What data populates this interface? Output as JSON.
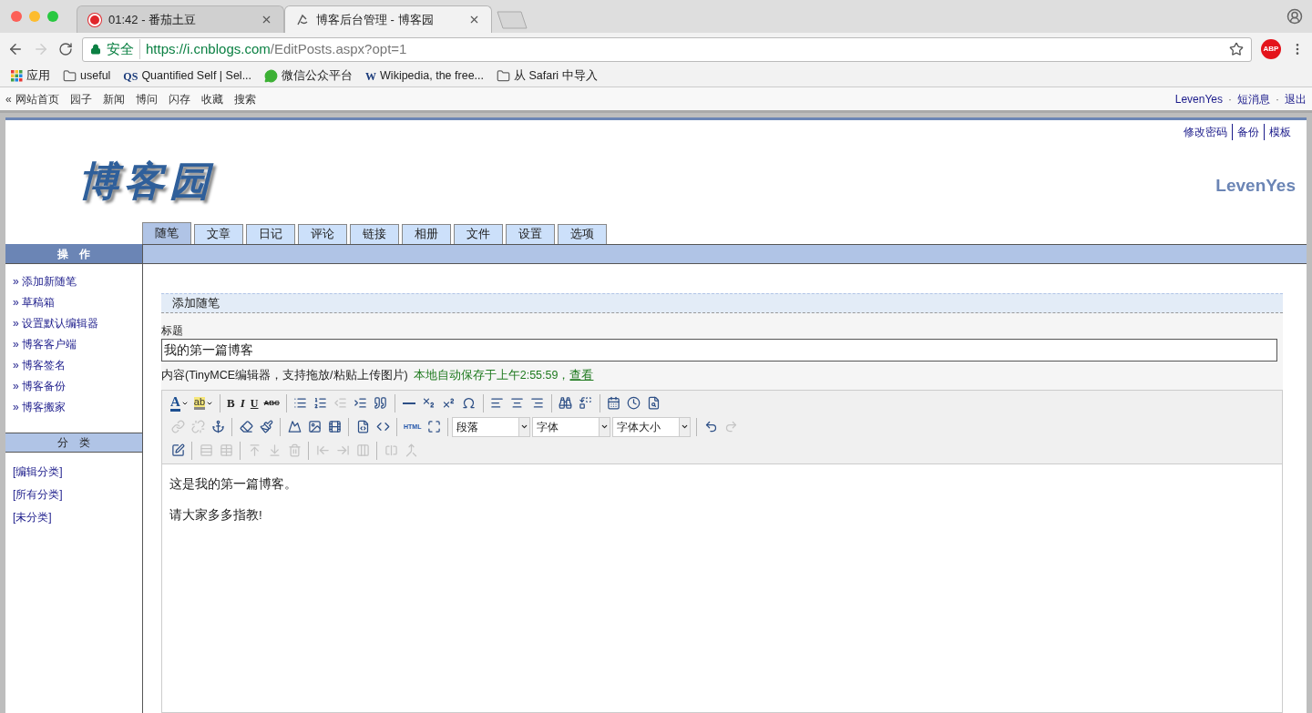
{
  "browser": {
    "tabs": [
      {
        "title": "01:42 - 番茄土豆",
        "kind": "tomato",
        "selected": false
      },
      {
        "title": "博客后台管理 - 博客园",
        "kind": "site",
        "selected": true
      }
    ],
    "back_disabled": false,
    "forward_disabled": true,
    "address": {
      "secure_label": "安全",
      "url_host": "https://i.cnblogs.com",
      "url_path": "/EditPosts.aspx?opt=1"
    },
    "extension_label": "ABP",
    "bookmarks": [
      {
        "kind": "apps",
        "label": "应用"
      },
      {
        "kind": "folder",
        "label": "useful"
      },
      {
        "kind": "badge",
        "badge": "QS",
        "label": "Quantified Self | Sel..."
      },
      {
        "kind": "chat",
        "label": "微信公众平台"
      },
      {
        "kind": "badge",
        "badge": "W",
        "label": "Wikipedia, the free..."
      },
      {
        "kind": "folder",
        "label": "从 Safari 中导入"
      }
    ]
  },
  "site_nav": {
    "marker": "«",
    "links": [
      "网站首页",
      "园子",
      "新闻",
      "博问",
      "闪存",
      "收藏",
      "搜索"
    ],
    "user_links": [
      "LevenYes",
      "短消息",
      "退出"
    ],
    "separator": "·"
  },
  "header": {
    "top_links": [
      "修改密码",
      "备份",
      "模板"
    ],
    "logo": "博客园",
    "username": "LevenYes"
  },
  "tabs": [
    {
      "label": "随笔",
      "selected": true
    },
    {
      "label": "文章",
      "selected": false
    },
    {
      "label": "日记",
      "selected": false
    },
    {
      "label": "评论",
      "selected": false
    },
    {
      "label": "链接",
      "selected": false
    },
    {
      "label": "相册",
      "selected": false
    },
    {
      "label": "文件",
      "selected": false
    },
    {
      "label": "设置",
      "selected": false
    },
    {
      "label": "选项",
      "selected": false
    }
  ],
  "sidebar": {
    "operations_title": "操　作",
    "bullet": "»",
    "operations": [
      "添加新随笔",
      "草稿箱",
      "设置默认编辑器",
      "博客客户端",
      "博客签名",
      "博客备份",
      "博客搬家"
    ],
    "categories_title": "分　类",
    "categories": [
      "[编辑分类]",
      "[所有分类]",
      "[未分类]"
    ]
  },
  "form": {
    "section_title": "添加随笔",
    "title_label": "标题",
    "title_value": "我的第一篇博客",
    "content_label": "内容(TinyMCE编辑器，支持拖放/粘贴上传图片)",
    "autosave_note": "本地自动保存于上午2:55:59，",
    "autosave_link": "查看"
  },
  "toolbar_rows": [
    [
      {
        "kind": "forecolor",
        "label": "A",
        "disabled": false
      },
      {
        "kind": "backcolor",
        "label": "ab",
        "disabled": false
      },
      {
        "kind": "separator"
      },
      {
        "kind": "bold",
        "label": "B",
        "disabled": false
      },
      {
        "kind": "italic",
        "label": "I",
        "disabled": false
      },
      {
        "kind": "underline",
        "label": "U",
        "disabled": false
      },
      {
        "kind": "strike",
        "label": "ABC",
        "disabled": false
      },
      {
        "kind": "separator"
      },
      {
        "kind": "bullist",
        "disabled": false
      },
      {
        "kind": "numlist",
        "disabled": false
      },
      {
        "kind": "outdent",
        "disabled": true
      },
      {
        "kind": "indent",
        "disabled": false
      },
      {
        "kind": "blockquote",
        "disabled": false
      },
      {
        "kind": "separator"
      },
      {
        "kind": "hr",
        "disabled": false
      },
      {
        "kind": "sub",
        "disabled": false
      },
      {
        "kind": "sup",
        "disabled": false
      },
      {
        "kind": "charmap",
        "disabled": false
      },
      {
        "kind": "separator"
      },
      {
        "kind": "alignleft",
        "disabled": false
      },
      {
        "kind": "aligncenter",
        "disabled": false
      },
      {
        "kind": "alignright",
        "disabled": false
      },
      {
        "kind": "separator"
      },
      {
        "kind": "search",
        "disabled": false
      },
      {
        "kind": "replace",
        "disabled": false
      },
      {
        "kind": "separator"
      },
      {
        "kind": "date",
        "disabled": false
      },
      {
        "kind": "time",
        "disabled": false
      },
      {
        "kind": "preview",
        "disabled": false
      }
    ],
    [
      {
        "kind": "link",
        "disabled": true
      },
      {
        "kind": "unlink",
        "disabled": true
      },
      {
        "kind": "anchor",
        "disabled": false
      },
      {
        "kind": "separator"
      },
      {
        "kind": "cleanup",
        "disabled": false
      },
      {
        "kind": "paint",
        "disabled": false
      },
      {
        "kind": "separator"
      },
      {
        "kind": "picture",
        "disabled": false
      },
      {
        "kind": "image",
        "disabled": false
      },
      {
        "kind": "media",
        "disabled": false
      },
      {
        "kind": "separator"
      },
      {
        "kind": "code",
        "disabled": false
      },
      {
        "kind": "code2",
        "disabled": false
      },
      {
        "kind": "separator"
      },
      {
        "kind": "html",
        "label": "HTML",
        "disabled": false
      },
      {
        "kind": "fullscreen",
        "disabled": false
      },
      {
        "kind": "separator"
      },
      {
        "kind": "select",
        "label": "段落"
      },
      {
        "kind": "select",
        "label": "字体"
      },
      {
        "kind": "select",
        "label": "字体大小"
      },
      {
        "kind": "separator"
      },
      {
        "kind": "undo",
        "disabled": false
      },
      {
        "kind": "redo",
        "disabled": true
      }
    ],
    [
      {
        "kind": "tableedit",
        "disabled": false
      },
      {
        "kind": "separator"
      },
      {
        "kind": "rowprops",
        "disabled": true
      },
      {
        "kind": "cellprops",
        "disabled": true
      },
      {
        "kind": "separator"
      },
      {
        "kind": "rowbefore",
        "disabled": true
      },
      {
        "kind": "rowafter",
        "disabled": true
      },
      {
        "kind": "rowdelete",
        "disabled": true
      },
      {
        "kind": "separator"
      },
      {
        "kind": "colbefore",
        "disabled": true
      },
      {
        "kind": "colafter",
        "disabled": true
      },
      {
        "kind": "coldelete",
        "disabled": true
      },
      {
        "kind": "separator"
      },
      {
        "kind": "split",
        "disabled": true
      },
      {
        "kind": "merge",
        "disabled": true
      }
    ]
  ],
  "editor_paragraphs": [
    "这是我的第一篇博客。",
    "请大家多多指教!"
  ]
}
